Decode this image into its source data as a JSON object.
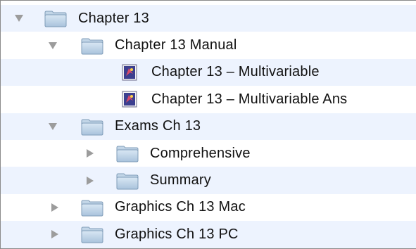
{
  "tree": {
    "items": [
      {
        "label": "Chapter 13",
        "icon": "folder-icon",
        "disclosure": "expanded"
      },
      {
        "label": "Chapter 13 Manual",
        "icon": "folder-icon",
        "disclosure": "expanded"
      },
      {
        "label": "Chapter 13 – Multivariable",
        "icon": "document-icon",
        "disclosure": "none"
      },
      {
        "label": "Chapter 13 – Multivariable Ans",
        "icon": "document-icon",
        "disclosure": "none"
      },
      {
        "label": "Exams Ch 13",
        "icon": "folder-icon",
        "disclosure": "expanded"
      },
      {
        "label": "Comprehensive",
        "icon": "folder-icon",
        "disclosure": "collapsed"
      },
      {
        "label": "Summary",
        "icon": "folder-icon",
        "disclosure": "collapsed"
      },
      {
        "label": "Graphics Ch 13 Mac",
        "icon": "folder-icon",
        "disclosure": "collapsed"
      },
      {
        "label": "Graphics Ch 13 PC",
        "icon": "folder-icon",
        "disclosure": "collapsed"
      }
    ]
  },
  "colors": {
    "row_stripe": "#edf3fe",
    "folder_fill": "#c3d6e8",
    "disclosure_triangle": "#9c9c9c"
  }
}
